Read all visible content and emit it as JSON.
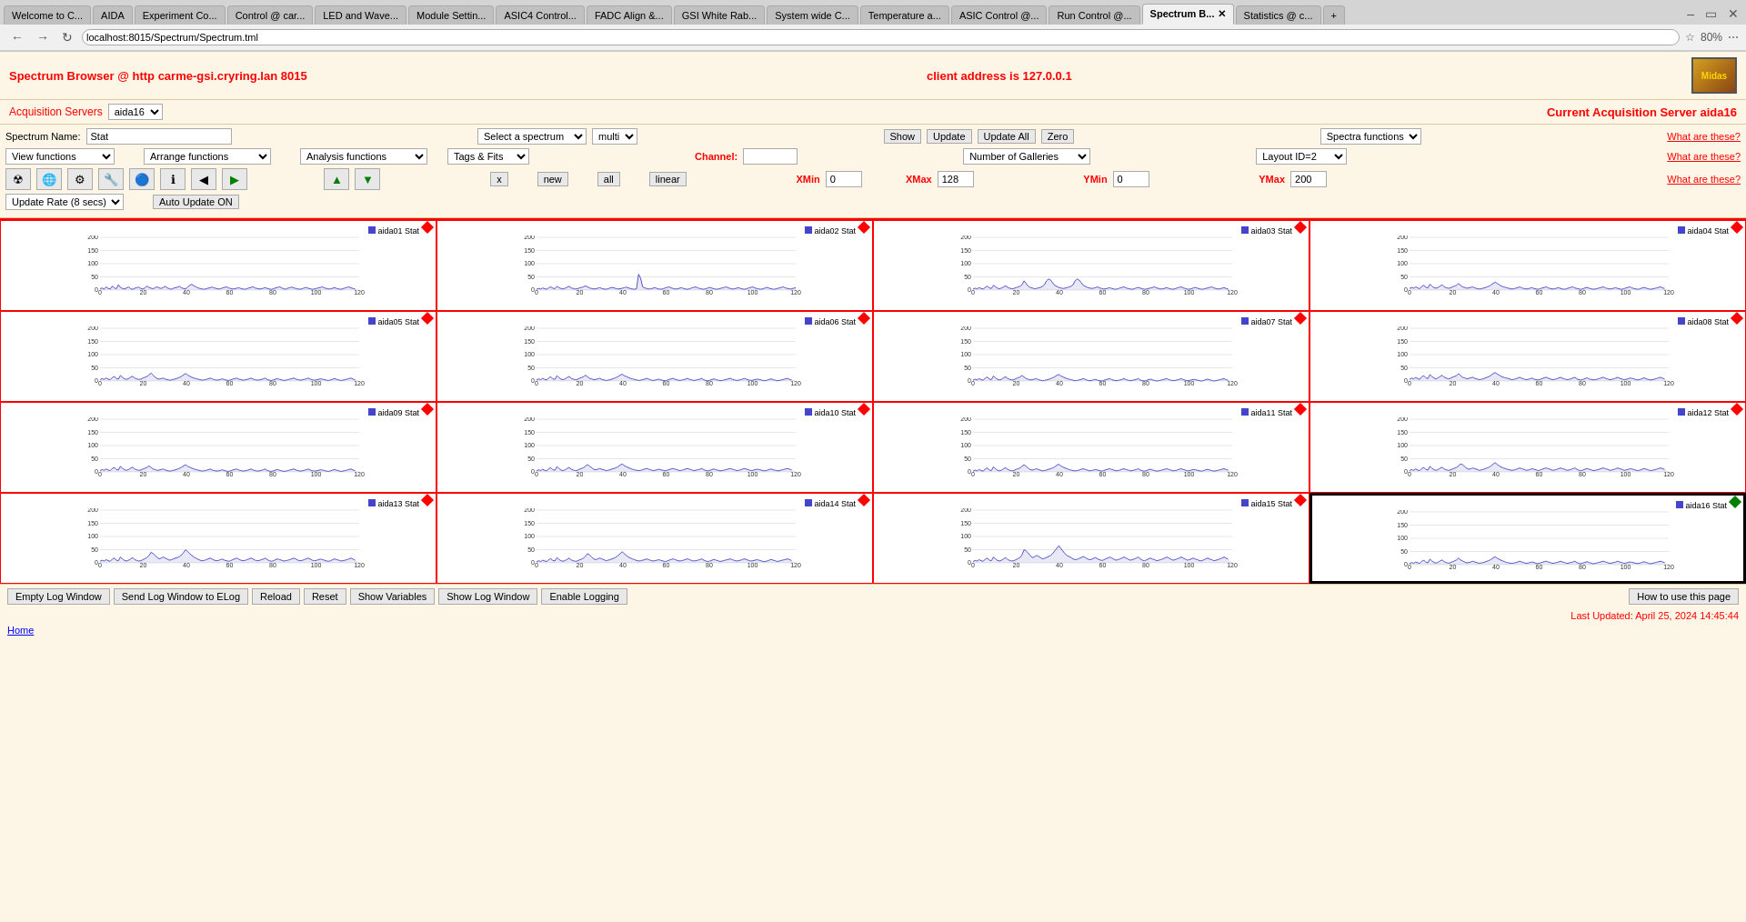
{
  "browser": {
    "tabs": [
      {
        "label": "Welcome to C...",
        "active": false
      },
      {
        "label": "AIDA",
        "active": false
      },
      {
        "label": "Experiment Co...",
        "active": false
      },
      {
        "label": "Control @ car...",
        "active": false
      },
      {
        "label": "LED and Wave...",
        "active": false
      },
      {
        "label": "Module Settin...",
        "active": false
      },
      {
        "label": "ASIC4 Control...",
        "active": false
      },
      {
        "label": "FADC Align &...",
        "active": false
      },
      {
        "label": "GSI White Rab...",
        "active": false
      },
      {
        "label": "System wide C...",
        "active": false
      },
      {
        "label": "Temperature a...",
        "active": false
      },
      {
        "label": "ASIC Control @...",
        "active": false
      },
      {
        "label": "Run Control @...",
        "active": false
      },
      {
        "label": "Spectrum B...",
        "active": true
      },
      {
        "label": "Statistics @ c...",
        "active": false
      }
    ],
    "address": "localhost:8015/Spectrum/Spectrum.tml",
    "zoom": "80%"
  },
  "header": {
    "title": "Spectrum Browser @ http carme-gsi.cryring.lan 8015",
    "client": "client address is 127.0.0.1"
  },
  "acquisition": {
    "label": "Acquisition Servers",
    "server_option": "aida16",
    "current_label": "Current Acquisition Server aida16"
  },
  "controls": {
    "spectrum_name_label": "Spectrum Name:",
    "spectrum_name_value": "Stat",
    "select_spectrum_label": "Select a spectrum",
    "multi_label": "multi",
    "show_label": "Show",
    "update_label": "Update",
    "update_all_label": "Update All",
    "zero_label": "Zero",
    "spectra_functions_label": "Spectra functions",
    "what_are_1": "What are these?",
    "view_functions_label": "View functions",
    "arrange_functions_label": "Arrange functions",
    "analysis_functions_label": "Analysis functions",
    "tags_fits_label": "Tags & Fits",
    "channel_label": "Channel:",
    "channel_value": "",
    "number_of_galleries_label": "Number of Galleries",
    "layout_id_label": "Layout ID=2",
    "what_are_2": "What are these?",
    "x_btn": "x",
    "new_btn": "new",
    "all_btn": "all",
    "linear_btn": "linear",
    "xmin_label": "XMin",
    "xmin_value": "0",
    "xmax_label": "XMax",
    "xmax_value": "128",
    "ymin_label": "YMin",
    "ymin_value": "0",
    "ymax_label": "YMax",
    "ymax_value": "200",
    "what_are_3": "What are these?",
    "update_rate_label": "Update Rate (8 secs)",
    "auto_update_label": "Auto Update ON"
  },
  "galleries": [
    {
      "id": "aida01",
      "label": "aida01 Stat",
      "active": false,
      "diamond": "red"
    },
    {
      "id": "aida02",
      "label": "aida02 Stat",
      "active": false,
      "diamond": "red"
    },
    {
      "id": "aida03",
      "label": "aida03 Stat",
      "active": false,
      "diamond": "red"
    },
    {
      "id": "aida04",
      "label": "aida04 Stat",
      "active": false,
      "diamond": "red"
    },
    {
      "id": "aida05",
      "label": "aida05 Stat",
      "active": false,
      "diamond": "red"
    },
    {
      "id": "aida06",
      "label": "aida06 Stat",
      "active": false,
      "diamond": "red"
    },
    {
      "id": "aida07",
      "label": "aida07 Stat",
      "active": false,
      "diamond": "red"
    },
    {
      "id": "aida08",
      "label": "aida08 Stat",
      "active": false,
      "diamond": "red"
    },
    {
      "id": "aida09",
      "label": "aida09 Stat",
      "active": false,
      "diamond": "red"
    },
    {
      "id": "aida10",
      "label": "aida10 Stat",
      "active": false,
      "diamond": "red"
    },
    {
      "id": "aida11",
      "label": "aida11 Stat",
      "active": false,
      "diamond": "red"
    },
    {
      "id": "aida12",
      "label": "aida12 Stat",
      "active": false,
      "diamond": "red"
    },
    {
      "id": "aida13",
      "label": "aida13 Stat",
      "active": false,
      "diamond": "red"
    },
    {
      "id": "aida14",
      "label": "aida14 Stat",
      "active": false,
      "diamond": "red"
    },
    {
      "id": "aida15",
      "label": "aida15 Stat",
      "active": false,
      "diamond": "red"
    },
    {
      "id": "aida16",
      "label": "aida16 Stat",
      "active": true,
      "diamond": "green"
    }
  ],
  "bottom": {
    "empty_log": "Empty Log Window",
    "send_log": "Send Log Window to ELog",
    "reload": "Reload",
    "reset": "Reset",
    "show_variables": "Show Variables",
    "show_log": "Show Log Window",
    "enable_logging": "Enable Logging",
    "how_to": "How to use this page"
  },
  "footer": {
    "last_updated": "Last Updated: April 25, 2024 14:45:44",
    "home": "Home"
  }
}
